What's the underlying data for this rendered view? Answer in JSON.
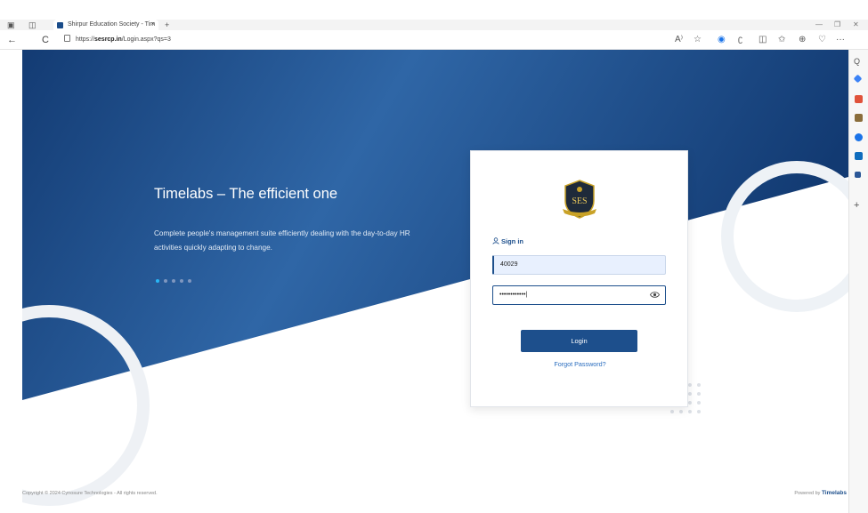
{
  "browser": {
    "tab_title": "Shirpur Education Society - Tim",
    "tab_close": "×",
    "new_tab": "+",
    "url_prefix": "https://",
    "url_host": "sesrcp.in",
    "url_path": "/Login.aspx?qs=3",
    "nav": {
      "back": "←",
      "refresh": "C"
    },
    "toolbar_icons": [
      "read-aloud-icon",
      "favorite-star-icon",
      "extension-icon",
      "copilot-icon",
      "split-screen-icon",
      "favorites-icon",
      "collections-icon",
      "browser-essentials-icon",
      "more-icon"
    ],
    "toolbar_glyphs": [
      "A⁾",
      "☆",
      "◉",
      "ʗ",
      "◫",
      "✩",
      "⊕",
      "♡",
      "···"
    ],
    "sidebar_glyphs": {
      "search": "Q",
      "add": "+"
    }
  },
  "hero": {
    "title": "Timelabs – The efficient one",
    "description": "Complete people's management suite efficiently dealing with the day-to-day HR activities quickly adapting to change.",
    "slides": 5,
    "active_slide": 1
  },
  "login": {
    "logo_text": "SES",
    "heading": "Sign in",
    "username_value": "40029",
    "password_value": "••••••••••••|",
    "button_label": "Login",
    "forgot_label": "Forgot Password?"
  },
  "footer": {
    "copyright": "Copyright © 2024 Cynosure Technologies - All rights reserved.",
    "powered_prefix": "Powered by",
    "powered_brand": "Timelabs"
  },
  "colors": {
    "hero_dark": "#143d75",
    "hero_mid": "#2f66a6",
    "primary": "#1d4f8c",
    "dot_active": "#29b6f6",
    "link": "#2a6dbf"
  }
}
